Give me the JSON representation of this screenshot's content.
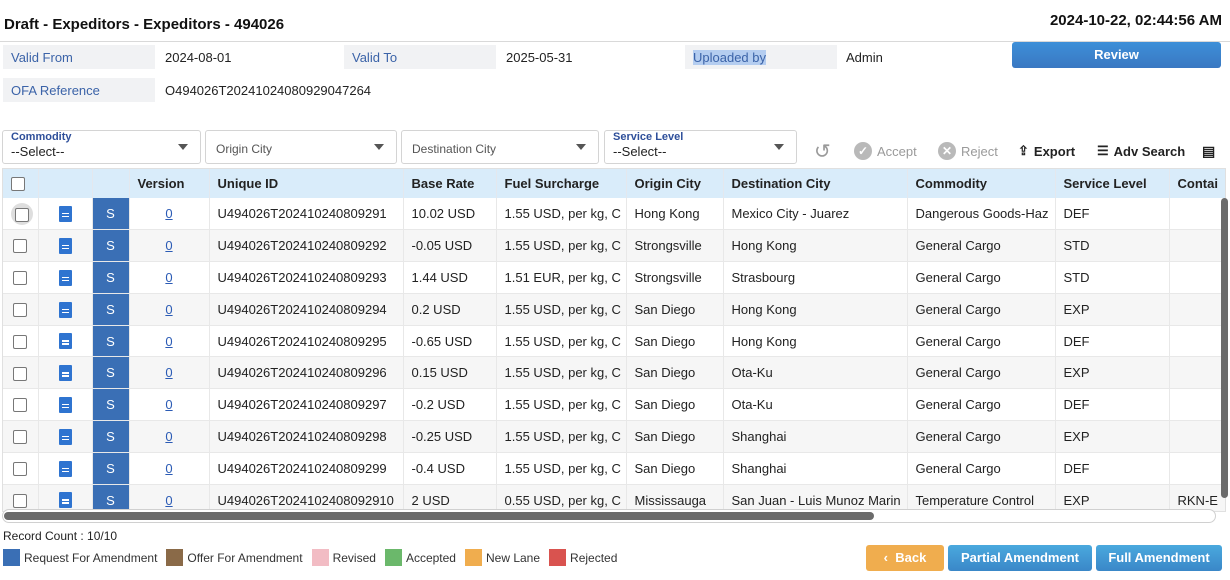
{
  "header": {
    "title": "Draft - Expeditors - Expeditors - 494026",
    "timestamp": "2024-10-22, 02:44:56 AM"
  },
  "meta": {
    "valid_from_label": "Valid From",
    "valid_from_value": "2024-08-01",
    "valid_to_label": "Valid To",
    "valid_to_value": "2025-05-31",
    "uploaded_by_label": "Uploaded by",
    "uploaded_by_value": "Admin",
    "ofa_label": "OFA Reference",
    "ofa_value": "O494026T20241024080929047264"
  },
  "review_button": "Review",
  "filters": {
    "commodity_label": "Commodity",
    "commodity_value": "--Select--",
    "origin_placeholder": "Origin City",
    "destination_placeholder": "Destination City",
    "service_label": "Service Level",
    "service_value": "--Select--"
  },
  "toolbar": {
    "accept": "Accept",
    "reject": "Reject",
    "export": "Export",
    "adv_search": "Adv Search"
  },
  "table": {
    "columns": [
      "Version",
      "Unique ID",
      "Base Rate",
      "Fuel Surcharge",
      "Origin City",
      "Destination City",
      "Commodity",
      "Service Level",
      "Contai"
    ],
    "rows": [
      {
        "status": "S",
        "version": "0",
        "id": "U494026T202410240809291",
        "base": "10.02 USD",
        "fuel": "1.55 USD, per kg, C",
        "origin": "Hong Kong",
        "dest": "Mexico City - Juarez",
        "commodity": "Dangerous Goods-Haz",
        "service": "DEF",
        "contai": ""
      },
      {
        "status": "S",
        "version": "0",
        "id": "U494026T202410240809292",
        "base": "-0.05 USD",
        "fuel": "1.55 USD, per kg, C",
        "origin": "Strongsville",
        "dest": "Hong Kong",
        "commodity": "General Cargo",
        "service": "STD",
        "contai": ""
      },
      {
        "status": "S",
        "version": "0",
        "id": "U494026T202410240809293",
        "base": "1.44 USD",
        "fuel": "1.51 EUR, per kg, C",
        "origin": "Strongsville",
        "dest": "Strasbourg",
        "commodity": "General Cargo",
        "service": "STD",
        "contai": ""
      },
      {
        "status": "S",
        "version": "0",
        "id": "U494026T202410240809294",
        "base": "0.2 USD",
        "fuel": "1.55 USD, per kg, C",
        "origin": "San Diego",
        "dest": "Hong Kong",
        "commodity": "General Cargo",
        "service": "EXP",
        "contai": ""
      },
      {
        "status": "S",
        "version": "0",
        "id": "U494026T202410240809295",
        "base": "-0.65 USD",
        "fuel": "1.55 USD, per kg, C",
        "origin": "San Diego",
        "dest": "Hong Kong",
        "commodity": "General Cargo",
        "service": "DEF",
        "contai": ""
      },
      {
        "status": "S",
        "version": "0",
        "id": "U494026T202410240809296",
        "base": "0.15 USD",
        "fuel": "1.55 USD, per kg, C",
        "origin": "San Diego",
        "dest": "Ota-Ku",
        "commodity": "General Cargo",
        "service": "EXP",
        "contai": ""
      },
      {
        "status": "S",
        "version": "0",
        "id": "U494026T202410240809297",
        "base": "-0.2 USD",
        "fuel": "1.55 USD, per kg, C",
        "origin": "San Diego",
        "dest": "Ota-Ku",
        "commodity": "General Cargo",
        "service": "DEF",
        "contai": ""
      },
      {
        "status": "S",
        "version": "0",
        "id": "U494026T202410240809298",
        "base": "-0.25 USD",
        "fuel": "1.55 USD, per kg, C",
        "origin": "San Diego",
        "dest": "Shanghai",
        "commodity": "General Cargo",
        "service": "EXP",
        "contai": ""
      },
      {
        "status": "S",
        "version": "0",
        "id": "U494026T202410240809299",
        "base": "-0.4 USD",
        "fuel": "1.55 USD, per kg, C",
        "origin": "San Diego",
        "dest": "Shanghai",
        "commodity": "General Cargo",
        "service": "DEF",
        "contai": ""
      },
      {
        "status": "S",
        "version": "0",
        "id": "U494026T2024102408092910",
        "base": "2 USD",
        "fuel": "0.55 USD, per kg, C",
        "origin": "Mississauga",
        "dest": "San Juan - Luis Munoz Marin",
        "commodity": "Temperature Control",
        "service": "EXP",
        "contai": "RKN-E"
      }
    ]
  },
  "record_count": "Record Count : 10/10",
  "legend": [
    {
      "label": "Request For Amendment",
      "color": "#3a6fb5"
    },
    {
      "label": "Offer For Amendment",
      "color": "#8a6a48"
    },
    {
      "label": "Revised",
      "color": "#f2bcc4"
    },
    {
      "label": "Accepted",
      "color": "#6bb86b"
    },
    {
      "label": "New Lane",
      "color": "#f0ad4e"
    },
    {
      "label": "Rejected",
      "color": "#d9534f"
    }
  ],
  "buttons": {
    "back": "Back",
    "partial": "Partial Amendment",
    "full": "Full Amendment"
  },
  "colors": {
    "header_row": "#d9ecfa",
    "status_cell": "#3a6fb5",
    "primary": "#3a87c8",
    "back": "#f0ad4e"
  }
}
